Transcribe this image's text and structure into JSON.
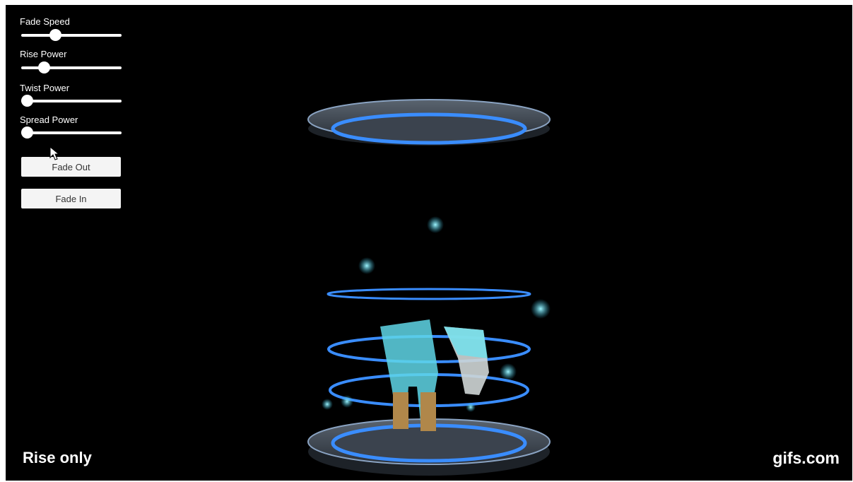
{
  "controls": {
    "sliders": [
      {
        "label": "Fade Speed",
        "value": 0.35
      },
      {
        "label": "Rise Power",
        "value": 0.23
      },
      {
        "label": "Twist Power",
        "value": 0.0
      },
      {
        "label": "Spread Power",
        "value": 0.0
      }
    ],
    "buttons": {
      "fade_out": "Fade Out",
      "fade_in": "Fade In"
    }
  },
  "overlay": {
    "caption": "Rise only",
    "watermark": "gifs.com"
  },
  "colors": {
    "background": "#000000",
    "ring_glow": "#3a8dff",
    "particle": "#7fe3f0"
  }
}
